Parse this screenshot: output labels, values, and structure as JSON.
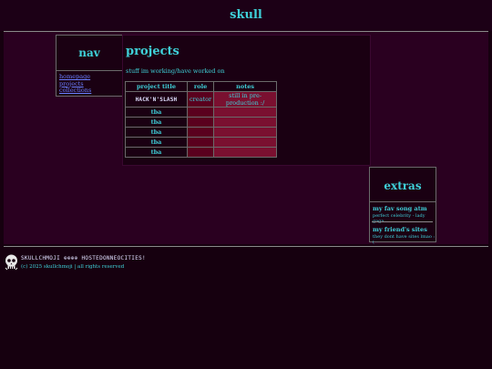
{
  "site": {
    "title": "skull"
  },
  "nav": {
    "title": "nav",
    "links": [
      "homepage",
      "projects",
      "collections"
    ]
  },
  "main": {
    "title": "projects",
    "description": "stuff im working/have worked on",
    "table": {
      "headers": [
        "project title",
        "role",
        "notes"
      ],
      "rows": [
        {
          "title": "HACK'N'SLASH",
          "role": "creator",
          "notes": "still in pre-production :/"
        },
        {
          "title": "tba",
          "role": "",
          "notes": ""
        },
        {
          "title": "tba",
          "role": "",
          "notes": ""
        },
        {
          "title": "tba",
          "role": "",
          "notes": ""
        },
        {
          "title": "tba",
          "role": "",
          "notes": ""
        },
        {
          "title": "tba",
          "role": "",
          "notes": ""
        }
      ]
    }
  },
  "extras": {
    "title": "extras",
    "items": [
      {
        "title": "my fav song atm",
        "desc": "perfect celebrity - lady gaga"
      },
      {
        "title": "my friend's sites",
        "desc": "they dont have sites lmao :("
      }
    ]
  },
  "footer": {
    "line1": "SKULLCHMOJI ⊕⊕⊕⊕ HOSTEDONNEOCITIES!",
    "line2": "(c) 2025 skullchmoji | all rights reserved"
  },
  "colors": {
    "accent": "#3fd0d8",
    "background": "#16000f",
    "cell": "#7a1030",
    "link": "#6a7fff"
  },
  "icons": {
    "footer": "skull-icon"
  }
}
